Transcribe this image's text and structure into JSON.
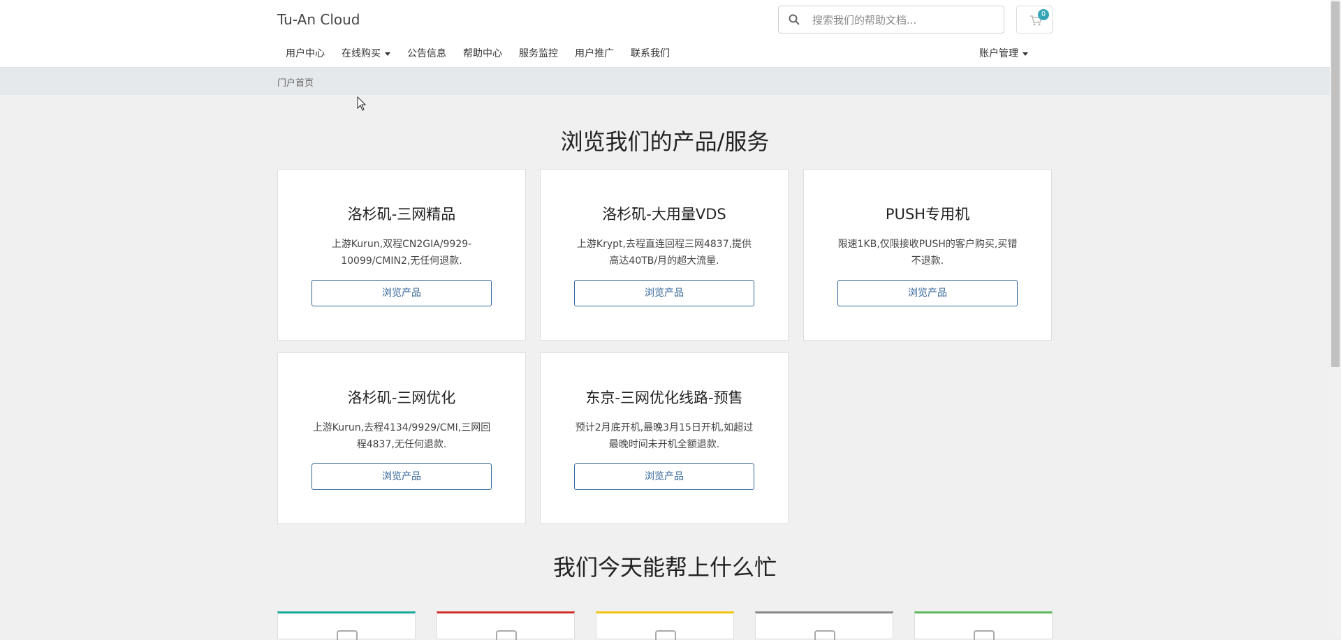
{
  "header": {
    "brand": "Tu-An Cloud",
    "search_placeholder": "搜索我们的帮助文档...",
    "cart_count": "0"
  },
  "nav": {
    "items": [
      {
        "label": "用户中心"
      },
      {
        "label": "在线购买",
        "dropdown": true
      },
      {
        "label": "公告信息"
      },
      {
        "label": "帮助中心"
      },
      {
        "label": "服务监控"
      },
      {
        "label": "用户推广"
      },
      {
        "label": "联系我们"
      }
    ],
    "account": "账户管理"
  },
  "breadcrumb": "门户首页",
  "products_section": {
    "title": "浏览我们的产品/服务",
    "cards": [
      {
        "title": "洛杉矶-三网精品",
        "desc": "上游Kurun,双程CN2GIA/9929-10099/CMIN2,无任何退款.",
        "button": "浏览产品"
      },
      {
        "title": "洛杉矶-大用量VDS",
        "desc": "上游Krypt,去程直连回程三网4837,提供高达40TB/月的超大流量.",
        "button": "浏览产品"
      },
      {
        "title": "PUSH专用机",
        "desc": "限速1KB,仅限接收PUSH的客户购买,买错不退款.",
        "button": "浏览产品"
      },
      {
        "title": "洛杉矶-三网优化",
        "desc": "上游Kurun,去程4134/9929/CMI,三网回程4837,无任何退款.",
        "button": "浏览产品"
      },
      {
        "title": "东京-三网优化线路-预售",
        "desc": "预计2月底开机,最晚3月15日开机,如超过最晚时间未开机全额退款.",
        "button": "浏览产品"
      }
    ]
  },
  "help_section": {
    "title": "我们今天能帮上什么忙",
    "cards": [
      {
        "accent": "#1aa89a"
      },
      {
        "accent": "#d0302c"
      },
      {
        "accent": "#f1c40f"
      },
      {
        "accent": "#888888"
      },
      {
        "accent": "#5cb85c"
      }
    ]
  },
  "colors": {
    "button": "#336699",
    "badge": "#33a5b7"
  }
}
